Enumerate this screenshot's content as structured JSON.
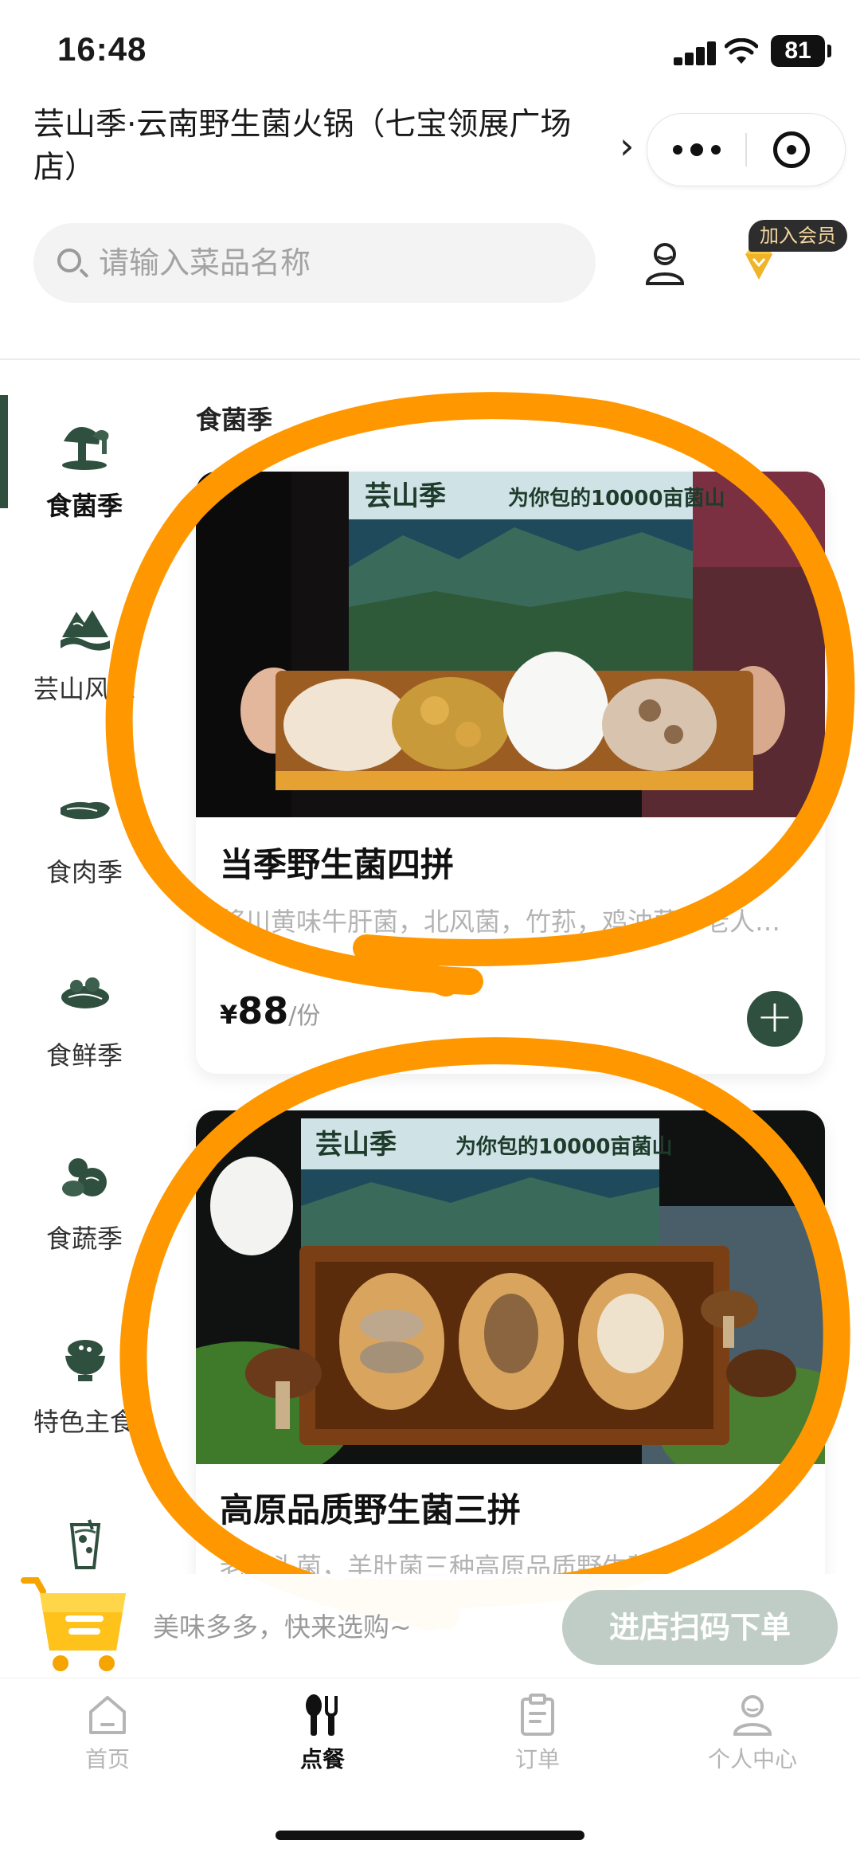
{
  "status_bar": {
    "time": "16:48",
    "battery": "81"
  },
  "header": {
    "shop_name": "芸山季·云南野生菌火锅（七宝领展广场店）"
  },
  "search": {
    "placeholder": "请输入菜品名称"
  },
  "vip": {
    "label": "加入会员"
  },
  "sidebar": {
    "items": [
      {
        "label": "食菌季",
        "icon": "mushroom-icon",
        "active": true
      },
      {
        "label": "芸山风味",
        "icon": "mountain-icon",
        "active": false
      },
      {
        "label": "食肉季",
        "icon": "meat-icon",
        "active": false
      },
      {
        "label": "食鲜季",
        "icon": "seafood-icon",
        "active": false
      },
      {
        "label": "食蔬季",
        "icon": "vegetable-icon",
        "active": false
      },
      {
        "label": "特色主食",
        "icon": "rice-bowl-icon",
        "active": false
      },
      {
        "label": "",
        "icon": "drink-icon",
        "active": false
      }
    ]
  },
  "menu": {
    "section_title": "食菌季",
    "items": [
      {
        "name": "当季野生菌四拼",
        "description": "将川黄味牛肝菌，北风菌，竹荪，鸡油菌，老人头菌四种当季野生菌拼盘",
        "price_symbol": "¥",
        "price": "88",
        "unit": "/份",
        "image_brand": "芸山季",
        "image_slogan": "为你包的10000亩菌山"
      },
      {
        "name": "高原品质野生菌三拼",
        "description": "老人头菌，羊肚菌三种高原品质野生菌",
        "image_brand": "芸山季",
        "image_slogan": "为你包的10000亩菌山"
      }
    ]
  },
  "cart": {
    "hint": "美味多多，快来选购~",
    "checkout_label": "进店扫码下单"
  },
  "tabs": [
    {
      "label": "首页",
      "icon": "home-icon",
      "active": false
    },
    {
      "label": "点餐",
      "icon": "utensils-icon",
      "active": true
    },
    {
      "label": "订单",
      "icon": "clipboard-icon",
      "active": false
    },
    {
      "label": "个人中心",
      "icon": "user-icon",
      "active": false
    }
  ],
  "colors": {
    "brand_green": "#2f4f3f",
    "annotation_orange": "#ff9800",
    "checkout_button": "#bfcdc6"
  }
}
